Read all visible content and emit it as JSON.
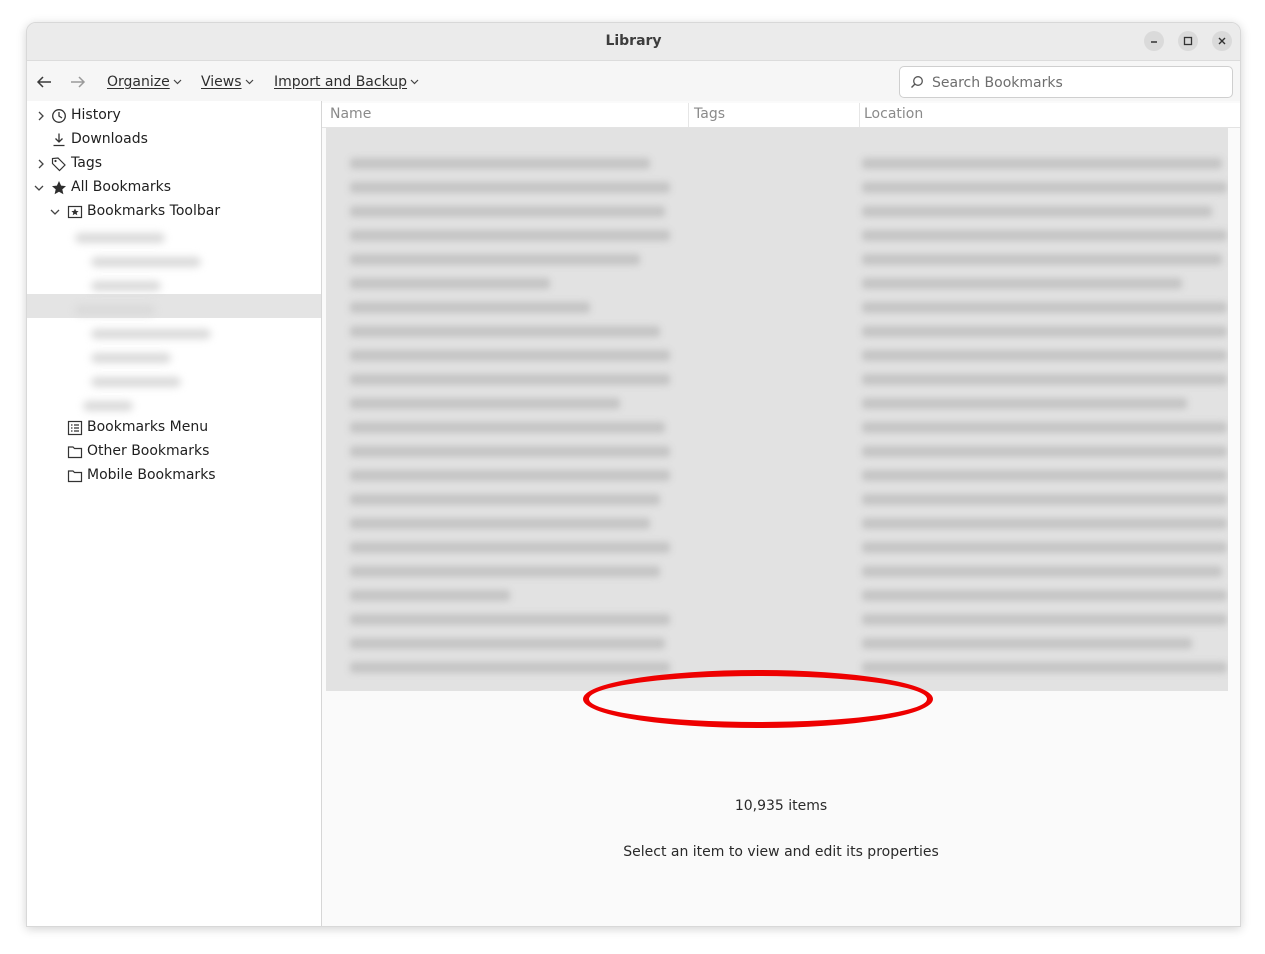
{
  "window": {
    "title": "Library"
  },
  "toolbar": {
    "menus": [
      {
        "label": "Organize"
      },
      {
        "label": "Views"
      },
      {
        "label": "Import and Backup"
      }
    ],
    "search_placeholder": "Search Bookmarks"
  },
  "sidebar": {
    "items": [
      {
        "label": "History",
        "icon": "clock-icon",
        "expander": "collapsed"
      },
      {
        "label": "Downloads",
        "icon": "download-icon",
        "expander": "none"
      },
      {
        "label": "Tags",
        "icon": "tag-icon",
        "expander": "collapsed"
      },
      {
        "label": "All Bookmarks",
        "icon": "star-icon",
        "expander": "expanded"
      },
      {
        "label": "Bookmarks Toolbar",
        "icon": "bookmarks-toolbar-icon",
        "expander": "expanded"
      },
      {
        "label": "Bookmarks Menu",
        "icon": "bookmarks-menu-icon",
        "expander": "none"
      },
      {
        "label": "Other Bookmarks",
        "icon": "folder-icon",
        "expander": "none"
      },
      {
        "label": "Mobile Bookmarks",
        "icon": "folder-icon",
        "expander": "none"
      }
    ]
  },
  "list": {
    "columns": [
      "Name",
      "Tags",
      "Location"
    ]
  },
  "details": {
    "item_count": "10,935 items",
    "hint": "Select an item to view and edit its properties"
  },
  "colors": {
    "annotation": "#ee0000",
    "list_background": "#e2e2e2"
  }
}
